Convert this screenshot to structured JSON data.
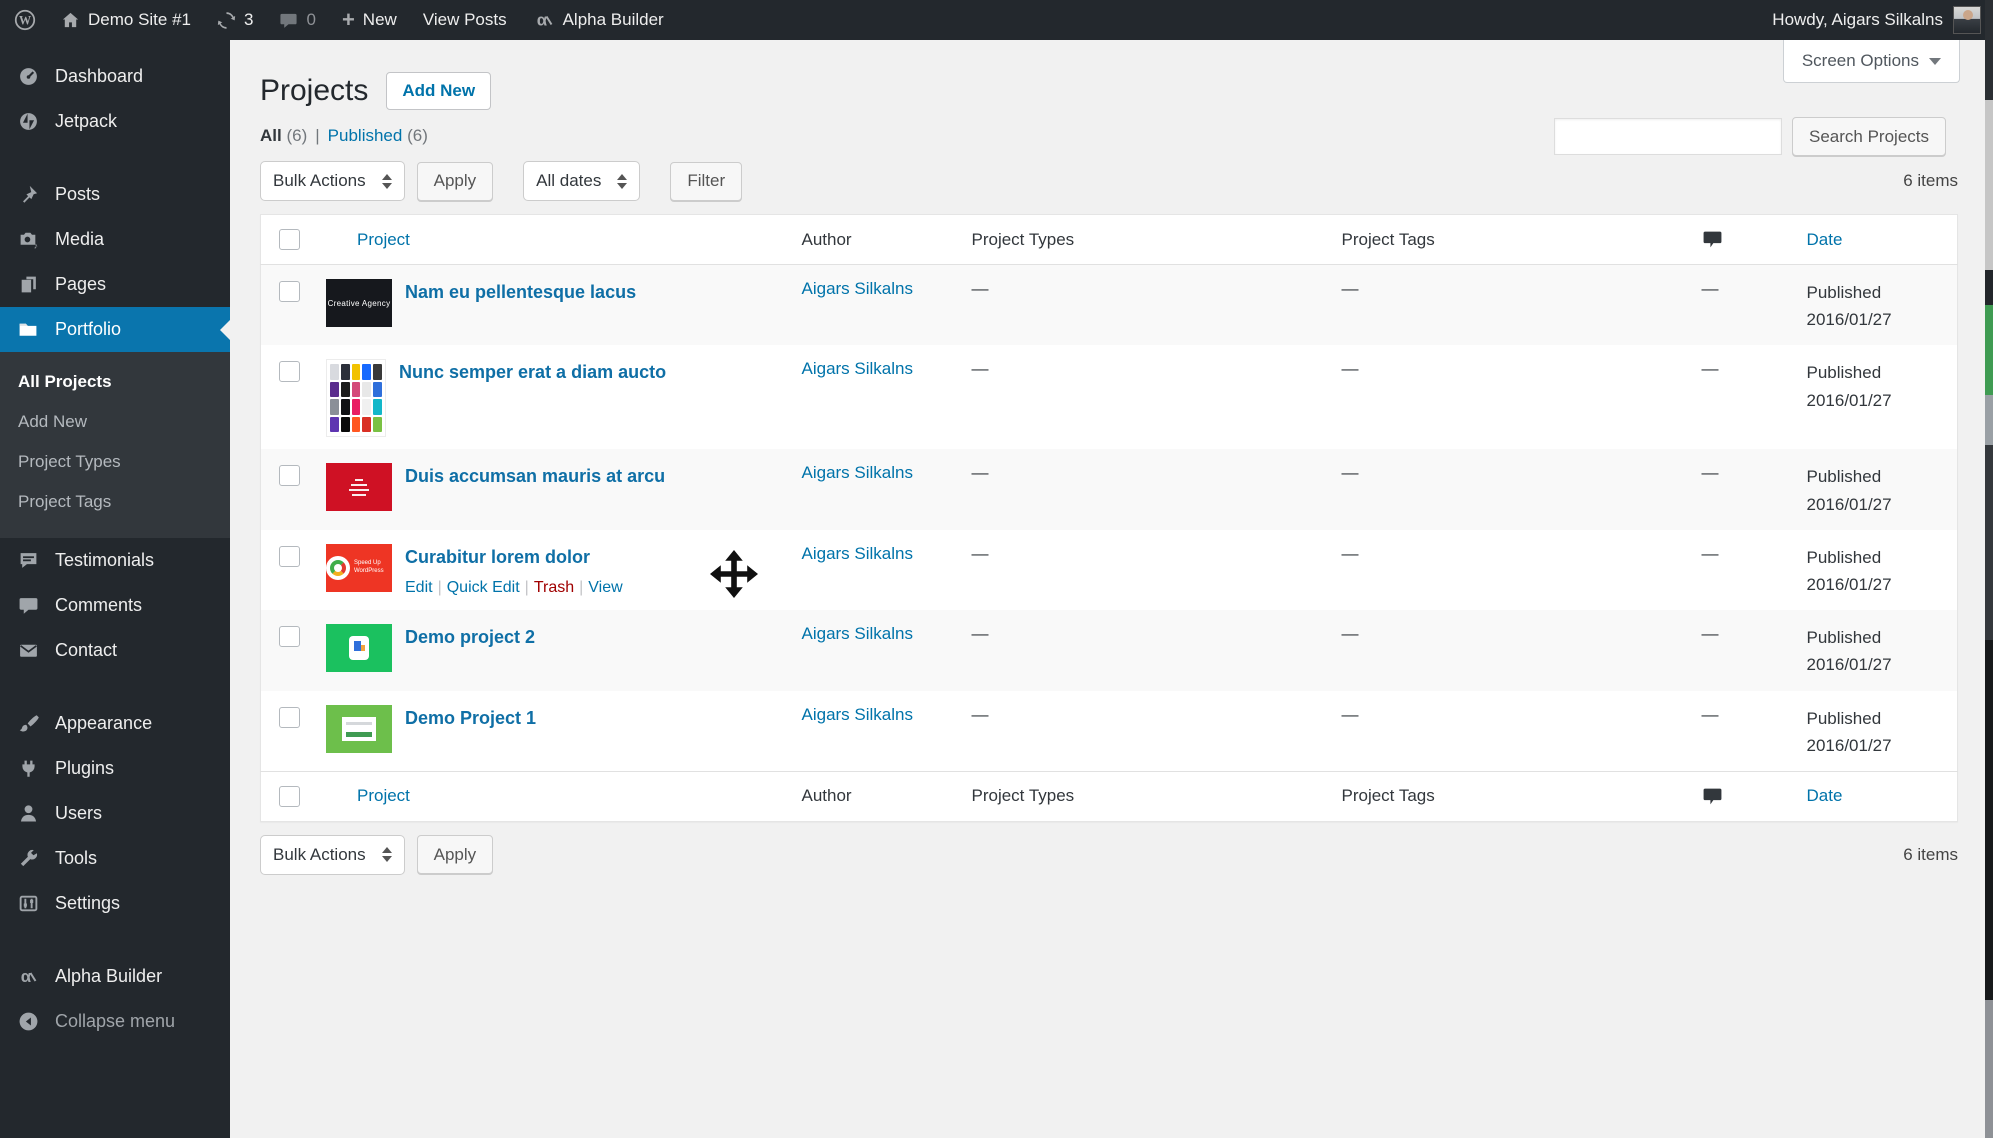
{
  "admin_bar": {
    "site_name": "Demo Site #1",
    "updates_count": "3",
    "comments_count": "0",
    "new_label": "New",
    "view_posts_label": "View Posts",
    "builder_label": "Alpha Builder",
    "howdy_text": "Howdy, Aigars Silkalns"
  },
  "sidebar": {
    "items": [
      {
        "label": "Dashboard",
        "icon": "dashboard-icon"
      },
      {
        "label": "Jetpack",
        "icon": "jetpack-icon"
      },
      {
        "label": "Posts",
        "icon": "pushpin-icon",
        "gap_before": true
      },
      {
        "label": "Media",
        "icon": "camera-icon"
      },
      {
        "label": "Pages",
        "icon": "pages-icon"
      },
      {
        "label": "Portfolio",
        "icon": "folder-icon",
        "active": true,
        "has_submenu": true
      },
      {
        "label": "Testimonials",
        "icon": "testimonial-bubble-icon"
      },
      {
        "label": "Comments",
        "icon": "comment-bubble-icon"
      },
      {
        "label": "Contact",
        "icon": "envelope-icon"
      },
      {
        "label": "Appearance",
        "icon": "brush-icon",
        "gap_before": true
      },
      {
        "label": "Plugins",
        "icon": "plug-icon"
      },
      {
        "label": "Users",
        "icon": "user-icon"
      },
      {
        "label": "Tools",
        "icon": "wrench-icon"
      },
      {
        "label": "Settings",
        "icon": "sliders-icon"
      },
      {
        "label": "Alpha Builder",
        "icon": "alpha-icon",
        "gap_before": true
      },
      {
        "label": "Collapse menu",
        "icon": "collapse-arrow-icon",
        "dim": true
      }
    ],
    "submenu": [
      {
        "label": "All Projects",
        "current": true
      },
      {
        "label": "Add New"
      },
      {
        "label": "Project Types"
      },
      {
        "label": "Project Tags"
      }
    ]
  },
  "page": {
    "title": "Projects",
    "add_new_label": "Add New",
    "screen_options_label": "Screen Options",
    "views": {
      "all_label": "All",
      "all_count": "(6)",
      "separator": "|",
      "published_label": "Published",
      "published_count": "(6)"
    },
    "search": {
      "value": "",
      "button_label": "Search Projects"
    },
    "toolbar": {
      "bulk_actions_label": "Bulk Actions",
      "apply_label": "Apply",
      "all_dates_label": "All dates",
      "filter_label": "Filter",
      "items_count": "6 items"
    }
  },
  "table": {
    "headers": {
      "project": "Project",
      "author": "Author",
      "types": "Project Types",
      "tags": "Project Tags",
      "date": "Date"
    },
    "action_separator": "|",
    "rows": [
      {
        "title": "Nam eu pellentesque lacus",
        "author": "Aigars Silkalns",
        "types": "—",
        "tags": "—",
        "comments": "—",
        "status": "Published",
        "date": "2016/01/27",
        "thumb": {
          "style": "dark-text",
          "bg": "#16181d",
          "label": "Creative Agency"
        }
      },
      {
        "title": "Nunc semper erat a diam aucto",
        "author": "Aigars Silkalns",
        "types": "—",
        "tags": "—",
        "comments": "—",
        "status": "Published",
        "date": "2016/01/27",
        "thumb": {
          "style": "icon-grid",
          "bg": "#ffffff"
        }
      },
      {
        "title": "Duis accumsan mauris at arcu",
        "author": "Aigars Silkalns",
        "types": "—",
        "tags": "—",
        "comments": "—",
        "status": "Published",
        "date": "2016/01/27",
        "thumb": {
          "style": "red-poster",
          "bg": "#cf1124"
        }
      },
      {
        "title": "Curabitur lorem dolor",
        "author": "Aigars Silkalns",
        "types": "—",
        "tags": "—",
        "comments": "—",
        "status": "Published",
        "date": "2016/01/27",
        "thumb": {
          "style": "red-logo",
          "bg": "#ee3524",
          "label": "Speed Up WordPress"
        },
        "actions": [
          {
            "label": "Edit",
            "type": "edit"
          },
          {
            "label": "Quick Edit",
            "type": "quick-edit"
          },
          {
            "label": "Trash",
            "type": "trash"
          },
          {
            "label": "View",
            "type": "view"
          }
        ],
        "show_move_cursor": true
      },
      {
        "title": "Demo project 2",
        "author": "Aigars Silkalns",
        "types": "—",
        "tags": "—",
        "comments": "—",
        "status": "Published",
        "date": "2016/01/27",
        "thumb": {
          "style": "green-app",
          "bg": "#1bc15f"
        }
      },
      {
        "title": "Demo Project 1",
        "author": "Aigars Silkalns",
        "types": "—",
        "tags": "—",
        "comments": "—",
        "status": "Published",
        "date": "2016/01/27",
        "thumb": {
          "style": "green-card",
          "bg": "#6dbf4b"
        }
      }
    ],
    "grid_palette": [
      "#d8dadf",
      "#2b2f3a",
      "#f2c200",
      "#1769ff",
      "#3a3a3a",
      "#5b2d8e",
      "#1b1b1b",
      "#d44a7a",
      "#e8e8e8",
      "#2f6fdb",
      "#8a8f98",
      "#101114",
      "#e91e63",
      "#f0f0f0",
      "#12b7c9",
      "#5e35b1",
      "#0a0a0a",
      "#ff5722",
      "#d93025",
      "#7ac143"
    ]
  },
  "colors": {
    "accent_blue": "#0a75ad",
    "link_blue": "#0073aa",
    "trash_red": "#a00000",
    "admin_dark": "#23282d",
    "submenu_dark": "#32373c",
    "content_bg": "#f1f1f1",
    "stripe_bg": "#f9f9f9"
  }
}
